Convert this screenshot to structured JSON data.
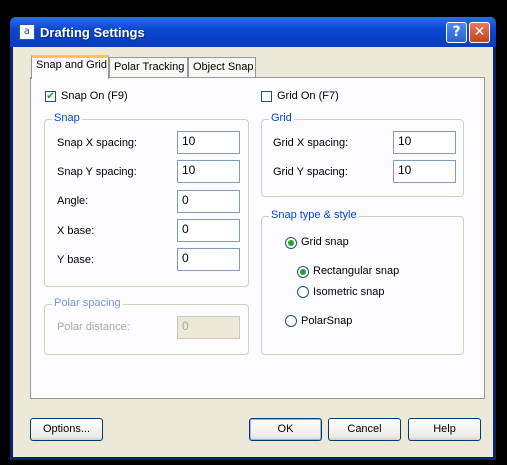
{
  "window": {
    "title": "Drafting Settings",
    "app_icon": "app-document-icon"
  },
  "titlebar_buttons": {
    "help": "?",
    "close": "✕"
  },
  "tabs": [
    {
      "label": "Snap and Grid",
      "active": true
    },
    {
      "label": "Polar Tracking",
      "active": false
    },
    {
      "label": "Object Snap",
      "active": false
    }
  ],
  "snap_on": {
    "label": "Snap On (F9)",
    "checked": true
  },
  "grid_on": {
    "label": "Grid On (F7)",
    "checked": false
  },
  "snap_group": {
    "title": "Snap",
    "fields": [
      {
        "label": "Snap X spacing:",
        "value": "10"
      },
      {
        "label": "Snap Y spacing:",
        "value": "10"
      },
      {
        "label": "Angle:",
        "value": "0"
      },
      {
        "label": "X base:",
        "value": "0"
      },
      {
        "label": "Y base:",
        "value": "0"
      }
    ]
  },
  "polar_group": {
    "title": "Polar spacing",
    "field": {
      "label": "Polar distance:",
      "value": "0",
      "disabled": true
    }
  },
  "grid_group": {
    "title": "Grid",
    "fields": [
      {
        "label": "Grid X spacing:",
        "value": "10"
      },
      {
        "label": "Grid Y spacing:",
        "value": "10"
      }
    ]
  },
  "snap_type_group": {
    "title": "Snap type & style",
    "options": [
      {
        "label": "Grid snap",
        "selected": true
      },
      {
        "label": "Rectangular snap",
        "selected": true
      },
      {
        "label": "Isometric snap",
        "selected": false
      },
      {
        "label": "PolarSnap",
        "selected": false
      }
    ]
  },
  "buttons": {
    "options": "Options...",
    "ok": "OK",
    "cancel": "Cancel",
    "help": "Help"
  },
  "colors": {
    "title_bar": "#0b49d0",
    "face": "#ece9d8",
    "group_title": "#0046d5",
    "tab_highlight": "#ffc83c"
  }
}
